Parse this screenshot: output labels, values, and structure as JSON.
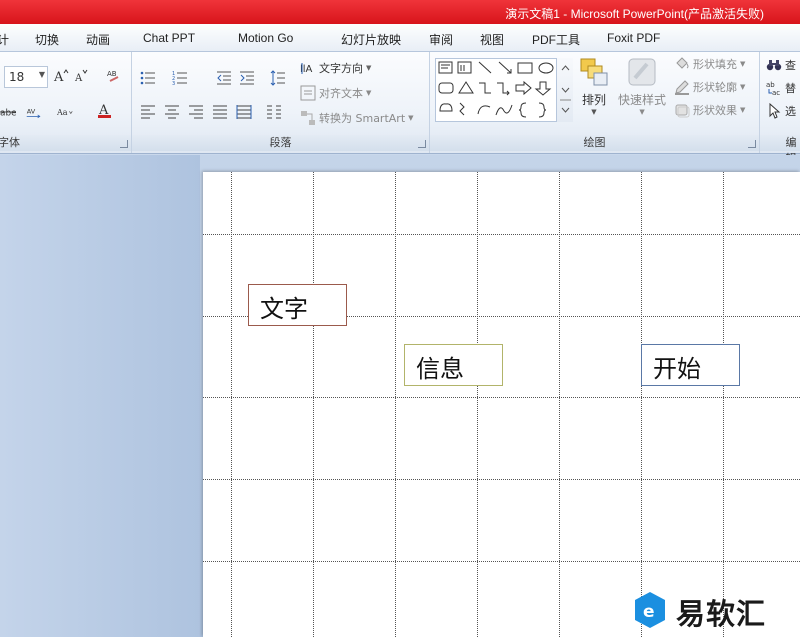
{
  "window": {
    "title": "演示文稿1 - Microsoft PowerPoint(产品激活失败)"
  },
  "tabs": [
    {
      "label": "计"
    },
    {
      "label": "切换"
    },
    {
      "label": "动画"
    },
    {
      "label": "Chat PPT"
    },
    {
      "label": "Motion Go"
    },
    {
      "label": "幻灯片放映"
    },
    {
      "label": "审阅"
    },
    {
      "label": "视图"
    },
    {
      "label": "PDF工具"
    },
    {
      "label": "Foxit PDF"
    }
  ],
  "ribbon": {
    "font": {
      "size_value": "18",
      "group_label": "字体"
    },
    "paragraph": {
      "group_label": "段落",
      "text_direction": "文字方向",
      "align_text": "对齐文本",
      "convert_smartart": "转换为 SmartArt"
    },
    "drawing": {
      "group_label": "绘图",
      "arrange": "排列",
      "quick_styles": "快速样式",
      "shape_fill": "形状填充",
      "shape_outline": "形状轮廓",
      "shape_effects": "形状效果"
    },
    "editing": {
      "group_label": "编辑",
      "find": "查",
      "replace": "替",
      "select": "选"
    }
  },
  "slide": {
    "textboxes": [
      {
        "text": "文字",
        "border_color": "#9b5a4c"
      },
      {
        "text": "信息",
        "border_color": "#b2b46a"
      },
      {
        "text": "开始",
        "border_color": "#5a78a6"
      }
    ]
  },
  "watermark": {
    "text": "易软汇",
    "color": "#1b8fe0"
  },
  "colors": {
    "titlebar": "#e21c22",
    "accent": "#1b8fe0"
  }
}
